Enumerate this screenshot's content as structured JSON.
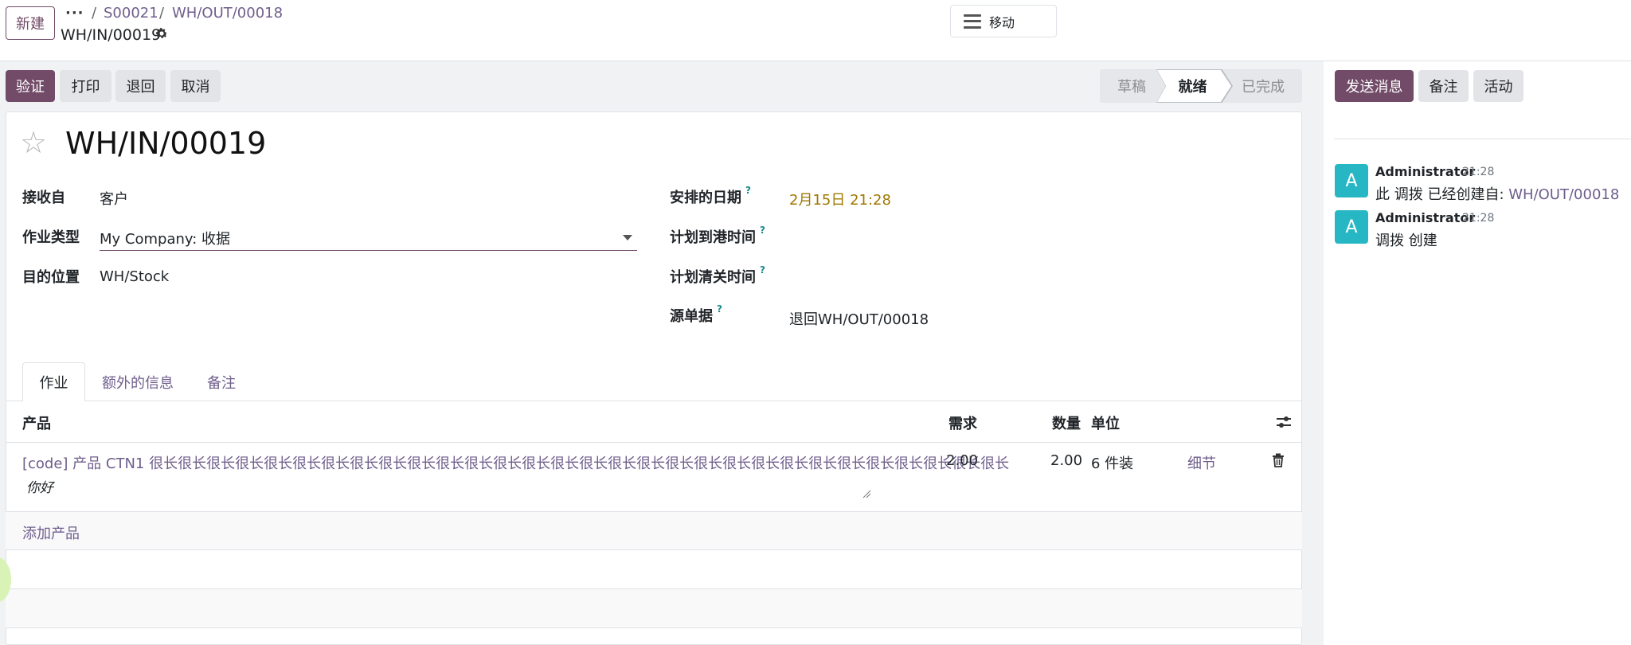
{
  "control_panel": {
    "new_label": "新建",
    "breadcrumb_dots": "···",
    "breadcrumb_sep": "/",
    "breadcrumb": [
      "S00021",
      "WH/OUT/00018"
    ],
    "record_name": "WH/IN/00019",
    "move_label": "移动"
  },
  "actions": {
    "validate": "验证",
    "print": "打印",
    "return": "退回",
    "cancel": "取消"
  },
  "statusbar": {
    "draft": "草稿",
    "ready": "就绪",
    "done": "已完成",
    "active": "就绪"
  },
  "form": {
    "title": "WH/IN/00019",
    "receive_from_label": "接收自",
    "receive_from_value": "客户",
    "operation_type_label": "作业类型",
    "operation_type_value": "My Company: 收据",
    "destination_label": "目的位置",
    "destination_value": "WH/Stock",
    "scheduled_date_label": "安排的日期",
    "scheduled_date_value": "2月15日 21:28",
    "eta_label": "计划到港时间",
    "clearance_label": "计划清关时间",
    "source_doc_label": "源单据",
    "source_doc_value": "退回WH/OUT/00018",
    "help_mark": "?"
  },
  "tabs": [
    "作业",
    "额外的信息",
    "备注"
  ],
  "table": {
    "headers": {
      "product": "产品",
      "demand": "需求",
      "quantity": "数量",
      "uom": "单位"
    },
    "rows": [
      {
        "product": "[code] 产品 CTN1 很长很长很长很长很长很长很长很长很长很长很长很长很长很长很长很长很长很长很长很长很长很长很长很长很长很长很长很长很长很长",
        "description": "你好",
        "demand": "2.00",
        "quantity": "2.00",
        "uom": "6 件装",
        "details": "细节"
      }
    ],
    "add_product": "添加产品"
  },
  "chatter": {
    "send_message": "发送消息",
    "log_note": "备注",
    "activity": "活动",
    "messages": [
      {
        "avatar": "A",
        "author": "Administrator",
        "time": "21:28",
        "text": "此 调拨 已经创建自: ",
        "link": "WH/OUT/00018"
      },
      {
        "avatar": "A",
        "author": "Administrator",
        "time": "21:28",
        "text": "调拨 创建"
      }
    ]
  },
  "colors": {
    "primary": "#714b67",
    "link": "#6e5e8c",
    "avatar": "#27b7c4",
    "date": "#a07800"
  }
}
